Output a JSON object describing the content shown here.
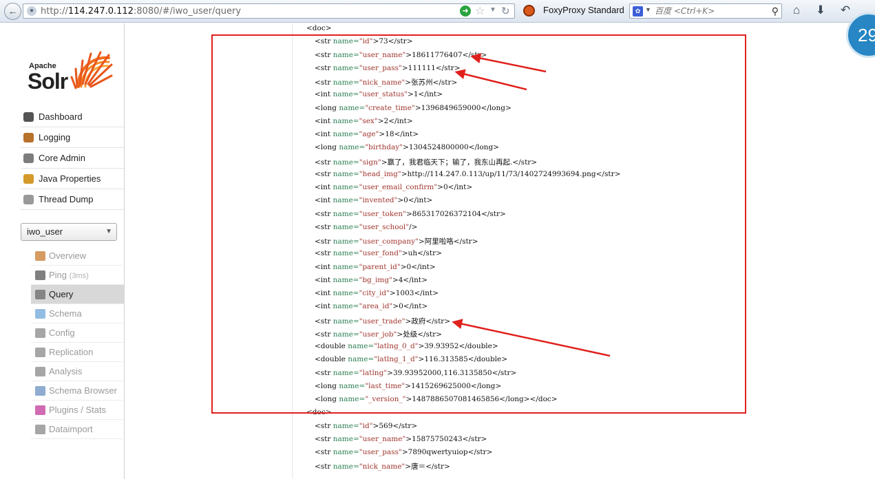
{
  "browser": {
    "url_prefix": "http://",
    "url_host": "114.247.0.112",
    "url_rest": ":8080/#/iwo_user/query",
    "proxy_label": "FoxyProxy Standard",
    "search_placeholder": "百度 <Ctrl+K>",
    "badge_text": "29"
  },
  "logo": {
    "apache": "Apache",
    "solr": "Solr"
  },
  "nav": [
    {
      "label": "Dashboard",
      "icon": "dashboard-icon",
      "color": "#555555"
    },
    {
      "label": "Logging",
      "icon": "logging-icon",
      "color": "#b8722c"
    },
    {
      "label": "Core Admin",
      "icon": "core-admin-icon",
      "color": "#7d7d7d"
    },
    {
      "label": "Java Properties",
      "icon": "java-icon",
      "color": "#d49a2a"
    },
    {
      "label": "Thread Dump",
      "icon": "thread-dump-icon",
      "color": "#999999"
    }
  ],
  "core_selector": {
    "value": "iwo_user"
  },
  "core_nav": [
    {
      "label": "Overview",
      "icon": "home-icon",
      "color": "#c77b2e",
      "note": ""
    },
    {
      "label": "Ping",
      "icon": "ping-icon",
      "color": "#555555",
      "note": "(3ms)"
    },
    {
      "label": "Query",
      "icon": "magnifier-icon",
      "color": "#6a6a6a",
      "note": ""
    },
    {
      "label": "Schema",
      "icon": "schema-icon",
      "color": "#6fa6d8",
      "note": ""
    },
    {
      "label": "Config",
      "icon": "config-icon",
      "color": "#888888",
      "note": ""
    },
    {
      "label": "Replication",
      "icon": "replication-icon",
      "color": "#888888",
      "note": ""
    },
    {
      "label": "Analysis",
      "icon": "analysis-icon",
      "color": "#888888",
      "note": ""
    },
    {
      "label": "Schema Browser",
      "icon": "schema-browser-icon",
      "color": "#6a8fc0",
      "note": ""
    },
    {
      "label": "Plugins / Stats",
      "icon": "plugins-icon",
      "color": "#c23a9a",
      "note": ""
    },
    {
      "label": "Dataimport",
      "icon": "dataimport-icon",
      "color": "#888888",
      "note": ""
    }
  ],
  "xml": {
    "doc_open": "<doc>",
    "doc1": [
      {
        "type": "str",
        "name": "id",
        "value": "73"
      },
      {
        "type": "str",
        "name": "user_name",
        "value": "18611776407"
      },
      {
        "type": "str",
        "name": "user_pass",
        "value": "111111"
      },
      {
        "type": "str",
        "name": "nick_name",
        "value": "张苏州"
      },
      {
        "type": "int",
        "name": "user_status",
        "value": "1"
      },
      {
        "type": "long",
        "name": "create_time",
        "value": "1396849659000"
      },
      {
        "type": "int",
        "name": "sex",
        "value": "2"
      },
      {
        "type": "int",
        "name": "age",
        "value": "18"
      },
      {
        "type": "long",
        "name": "birthday",
        "value": "1304524800000"
      },
      {
        "type": "str",
        "name": "sign",
        "value": "赢了，我君临天下；输了，我东山再起."
      },
      {
        "type": "str",
        "name": "head_img",
        "value": "http://114.247.0.113/up/11/73/1402724993694.png"
      },
      {
        "type": "int",
        "name": "user_email_confirm",
        "value": "0"
      },
      {
        "type": "int",
        "name": "invented",
        "value": "0"
      },
      {
        "type": "str",
        "name": "user_token",
        "value": "865317026372104"
      },
      {
        "type": "str",
        "name": "user_school",
        "value": "",
        "selfclose": true
      },
      {
        "type": "str",
        "name": "user_company",
        "value": "阿里啦咯"
      },
      {
        "type": "str",
        "name": "user_fond",
        "value": "uh"
      },
      {
        "type": "int",
        "name": "parent_id",
        "value": "0"
      },
      {
        "type": "int",
        "name": "bg_img",
        "value": "4"
      },
      {
        "type": "int",
        "name": "city_id",
        "value": "1003"
      },
      {
        "type": "int",
        "name": "area_id",
        "value": "0"
      },
      {
        "type": "str",
        "name": "user_trade",
        "value": "政府"
      },
      {
        "type": "str",
        "name": "user_job",
        "value": "处级"
      },
      {
        "type": "double",
        "name": "latlng_0_d",
        "value": "39.93952"
      },
      {
        "type": "double",
        "name": "latlng_1_d",
        "value": "116.313585"
      },
      {
        "type": "str",
        "name": "latlng",
        "value": "39.93952000,116.3135850"
      },
      {
        "type": "long",
        "name": "last_time",
        "value": "1415269625000"
      },
      {
        "type": "long",
        "name": "_version_",
        "value": "1487886507081465856",
        "closedoc": true
      }
    ],
    "doc2": [
      {
        "type": "str",
        "name": "id",
        "value": "569"
      },
      {
        "type": "str",
        "name": "user_name",
        "value": "15875750243"
      },
      {
        "type": "str",
        "name": "user_pass",
        "value": "7890qwertyuiop"
      },
      {
        "type": "str",
        "name": "nick_name",
        "value": "唐＝"
      }
    ]
  },
  "annotation": {
    "box_color": "#e0201c",
    "arrow_color": "#e0201c"
  }
}
